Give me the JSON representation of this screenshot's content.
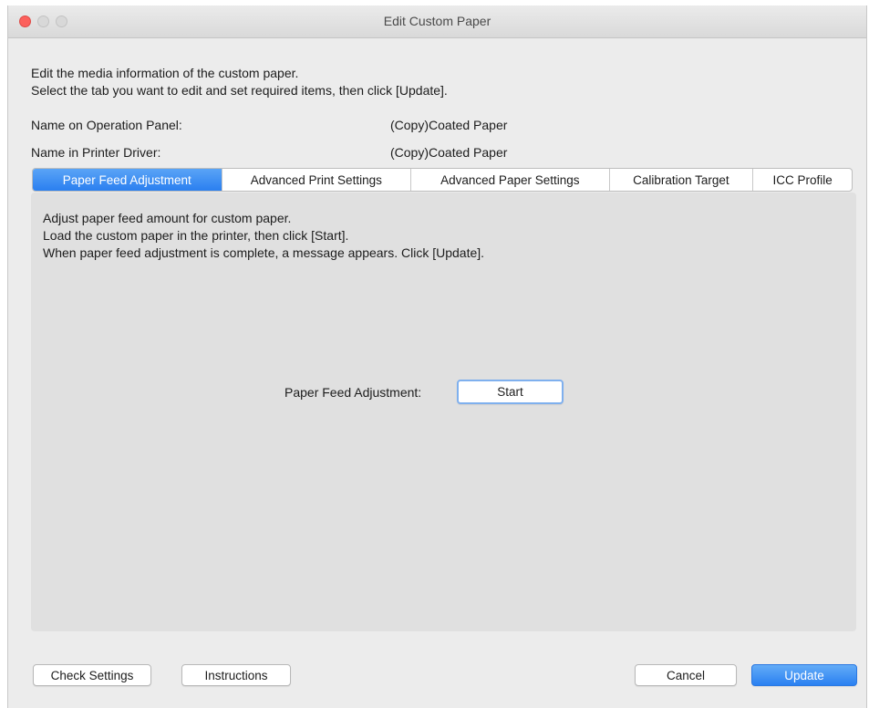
{
  "window": {
    "title": "Edit Custom Paper"
  },
  "intro": {
    "line1": "Edit the media information of the custom paper.",
    "line2": "Select the tab you want to edit and set required items, then click [Update]."
  },
  "names": {
    "operation_panel_label": "Name on Operation Panel:",
    "operation_panel_value": "(Copy)Coated Paper",
    "printer_driver_label": "Name in Printer Driver:",
    "printer_driver_value": "(Copy)Coated Paper"
  },
  "tabs": [
    {
      "label": "Paper Feed Adjustment",
      "active": true
    },
    {
      "label": "Advanced Print Settings",
      "active": false
    },
    {
      "label": "Advanced Paper Settings",
      "active": false
    },
    {
      "label": "Calibration Target",
      "active": false
    },
    {
      "label": "ICC Profile",
      "active": false
    }
  ],
  "panel": {
    "line1": "Adjust paper feed amount for custom paper.",
    "line2": "Load the custom paper in the printer, then click [Start].",
    "line3": "When paper feed adjustment is complete, a message appears. Click [Update].",
    "adjust_label": "Paper Feed Adjustment:",
    "start_button": "Start"
  },
  "footer": {
    "check_settings": "Check Settings",
    "instructions": "Instructions",
    "cancel": "Cancel",
    "update": "Update"
  },
  "colors": {
    "accent": "#2a80f1",
    "close_button": "#fc605c"
  }
}
